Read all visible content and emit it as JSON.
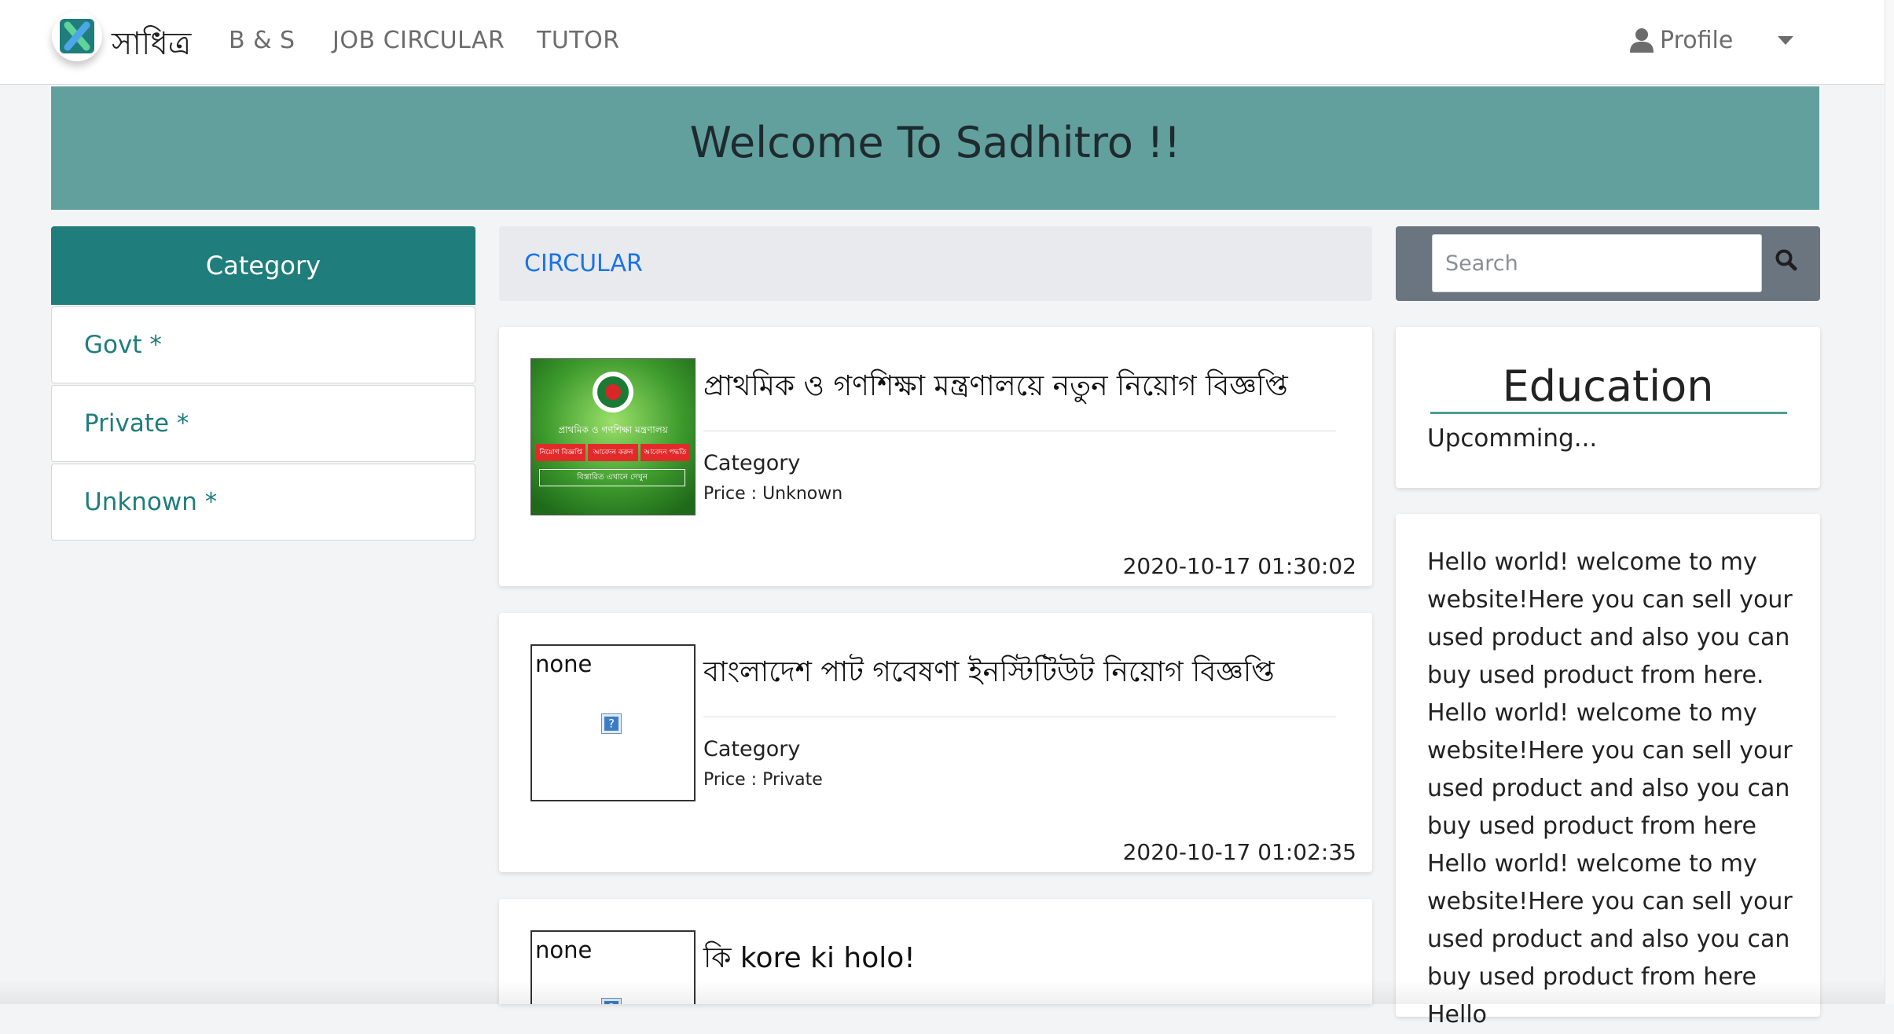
{
  "nav": {
    "brand": "সাধিত্র",
    "links": [
      "B & S",
      "JOB CIRCULAR",
      "TUTOR"
    ],
    "profile_label": "Profile"
  },
  "banner": {
    "title": "Welcome To Sadhitro !!"
  },
  "sidebar": {
    "header": "Category",
    "items": [
      "Govt *",
      "Private *",
      "Unknown *"
    ]
  },
  "main": {
    "section_title": "CIRCULAR",
    "cards": [
      {
        "title": "প্রাথমিক ও গণশিক্ষা মন্ত্রণালয়ে নতুন নিয়োগ বিজ্ঞপ্তি",
        "category": "Category",
        "price": "Price : Unknown",
        "date": "2020-10-17 01:30:02",
        "thumb": {
          "heading": "প্রাথমিক ও গণশিক্ষা মন্ত্রণালয়",
          "tags": [
            "নিয়োগ বিজ্ঞপ্তি",
            "আবেদন করুন",
            "আবেদন পদ্ধতি"
          ],
          "footer": "বিস্তারিত এখানে দেখুন"
        }
      },
      {
        "title": "বাংলাদেশ পাট গবেষণা ইনস্টিটিউট নিয়োগ বিজ্ঞপ্তি",
        "alt": "none",
        "category": "Category",
        "price": "Price : Private",
        "date": "2020-10-17 01:02:35"
      },
      {
        "title": "কি kore ki holo!",
        "alt": "none"
      }
    ]
  },
  "search": {
    "placeholder": "Search"
  },
  "education": {
    "title": "Education",
    "subtitle": "Upcomming..."
  },
  "about": {
    "text": "Hello world! welcome to my website!Here you can sell your used product and also you can buy used product from here. Hello world! welcome to my website!Here you can sell your used product and also you can buy used product from here Hello world! welcome to my website!Here you can sell your used product and also you can buy used product from here Hello"
  },
  "colors": {
    "teal_dark": "#1f7d7b",
    "banner": "#62a09e",
    "link_blue": "#1a73e8",
    "search_bg": "#6a7580"
  }
}
